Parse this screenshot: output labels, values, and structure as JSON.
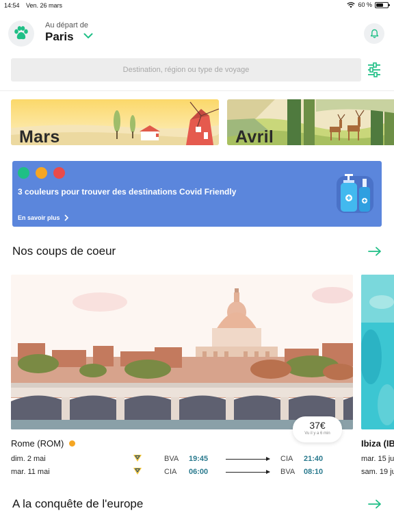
{
  "status_bar": {
    "time": "14:54",
    "date": "Ven. 26 mars",
    "battery": "60 %",
    "battery_level": 0.6
  },
  "header": {
    "departure_label": "Au départ de",
    "departure_city": "Paris"
  },
  "search": {
    "placeholder": "Destination, région ou type de voyage"
  },
  "months": [
    {
      "label": "Mars"
    },
    {
      "label": "Avril"
    }
  ],
  "covid_banner": {
    "text": "3 couleurs pour trouver des destinations Covid Friendly",
    "link": "En savoir plus",
    "dot_colors": [
      "#1fbf86",
      "#f5a623",
      "#e94b4b"
    ]
  },
  "sections": [
    {
      "title": "Nos coups de coeur"
    },
    {
      "title": "A la conquête de l'europe"
    }
  ],
  "deals": [
    {
      "destination": "Rome (ROM)",
      "status_color": "#f5a623",
      "price": "37€",
      "updated": "Vu il y a 6 min",
      "flights": [
        {
          "date": "dim. 2 mai",
          "from": "BVA",
          "dep": "19:45",
          "to": "CIA",
          "arr": "21:40"
        },
        {
          "date": "mar. 11 mai",
          "from": "CIA",
          "dep": "06:00",
          "to": "BVA",
          "arr": "08:10"
        }
      ]
    },
    {
      "destination": "Ibiza (IB",
      "flights": [
        {
          "date": "mar. 15 jui"
        },
        {
          "date": "sam. 19 ju"
        }
      ]
    }
  ],
  "colors": {
    "accent": "#1fbf86",
    "banner": "#5b86dc",
    "time_text": "#2a7a8e"
  }
}
